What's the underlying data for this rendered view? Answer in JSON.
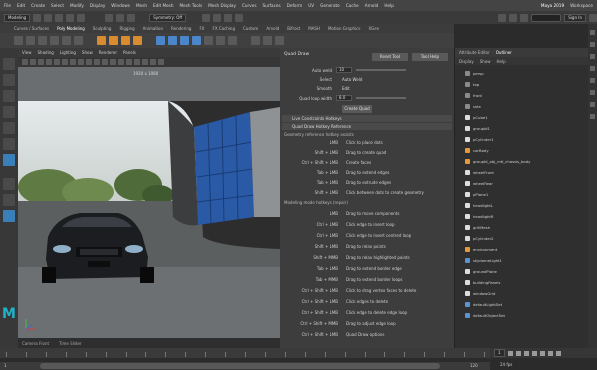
{
  "app": {
    "title": "Maya 2019",
    "logo_letter": "M",
    "accent": "#1fb3c8"
  },
  "menubar": {
    "items": [
      "File",
      "Edit",
      "Create",
      "Select",
      "Modify",
      "Display",
      "Windows",
      "Mesh",
      "Edit Mesh",
      "Mesh Tools",
      "Mesh Display",
      "Curves",
      "Surfaces",
      "Deform",
      "UV",
      "Generate",
      "Cache",
      "Arnold",
      "Help"
    ],
    "workspace": "Workspace"
  },
  "status": {
    "mode": "Modeling",
    "symmetry": "Symmetry: Off",
    "sign_in": "Sign In"
  },
  "shelf": {
    "tabs": [
      "Curves / Surfaces",
      "Poly Modeling",
      "Sculpting",
      "Rigging",
      "Animation",
      "Rendering",
      "FX",
      "FX Caching",
      "Custom",
      "Arnold",
      "Bifrost",
      "MASH",
      "Motion Graphics",
      "XGen"
    ],
    "active": "Poly Modeling"
  },
  "viewport": {
    "menu": [
      "View",
      "Shading",
      "Lighting",
      "Show",
      "Renderer",
      "Panels"
    ],
    "bottom_left": "Camera Front",
    "bottom_mid": "Time Slider",
    "res_label": "1920 x 1080"
  },
  "tool_settings": {
    "title": "Quad Draw",
    "reset_tool": "Reset Tool",
    "tool_help": "Tool Help",
    "fields": [
      {
        "label": "Auto weld",
        "value": "10"
      },
      {
        "label": "Select",
        "value": "Auto Weld"
      },
      {
        "label": "Smooth",
        "value": "Edit"
      },
      {
        "label": "Quad loop width",
        "value": "8.0"
      }
    ],
    "create_button": "Create Quad",
    "sections": [
      "Live Constraints Hotkeys",
      "Quad Draw Hotkey Reference"
    ],
    "section_caption": "Geometry reference hotkey assists",
    "hotkeys_top": [
      {
        "key": "LMB",
        "desc": "Click to place dots"
      },
      {
        "key": "Shift + LMB",
        "desc": "Drag to create quad"
      },
      {
        "key": "Ctrl + Shift + LMB",
        "desc": "Create faces"
      },
      {
        "key": "Tab + LMB",
        "desc": "Drag to extend edges"
      },
      {
        "key": "Tab + LMB",
        "desc": "Drag to extrude edges"
      },
      {
        "key": "Shift + LMB",
        "desc": "Click between dots to create geometry"
      }
    ],
    "caption_2": "Modeling mode hotkeys (repair)",
    "hotkeys_bottom": [
      {
        "key": "LMB",
        "desc": "Drag to move components"
      },
      {
        "key": "Ctrl + LMB",
        "desc": "Click edge to insert loop"
      },
      {
        "key": "Ctrl + LMB",
        "desc": "Click edge to insert centred loop"
      },
      {
        "key": "Shift + LMB",
        "desc": "Drag to relax points"
      },
      {
        "key": "Shift + MMB",
        "desc": "Drag to relax highlighted points"
      },
      {
        "key": "Tab + LMB",
        "desc": "Drag to extend border edge"
      },
      {
        "key": "Tab + MMB",
        "desc": "Drag to extend border loops"
      },
      {
        "key": "Ctrl + Shift + LMB",
        "desc": "Click to drag vertex faces to delete"
      },
      {
        "key": "Ctrl + Shift + LMB",
        "desc": "Click edges to delete"
      },
      {
        "key": "Ctrl + Shift + LMB",
        "desc": "Click edge to delete edge loop"
      },
      {
        "key": "Ctrl + Shift + MMB",
        "desc": "Drag to adjust edge loop"
      },
      {
        "key": "Ctrl + Shift + LMB",
        "desc": "Quad Draw options"
      }
    ]
  },
  "outliner": {
    "tabs": [
      "Attribute Editor",
      "Outliner"
    ],
    "active_tab": "Outliner",
    "menu": [
      "Display",
      "Show",
      "Help"
    ],
    "items": [
      {
        "name": "persp",
        "icon": "camera"
      },
      {
        "name": "top",
        "icon": "camera"
      },
      {
        "name": "front",
        "icon": "camera"
      },
      {
        "name": "side",
        "icon": "camera"
      },
      {
        "name": "pCube1",
        "icon": "mesh"
      },
      {
        "name": "groupId1",
        "icon": "mesh"
      },
      {
        "name": "pCylinder1",
        "icon": "mesh"
      },
      {
        "name": "carBody",
        "icon": "group"
      },
      {
        "name": "groupId_obj_mtl_chassis_body",
        "icon": "group"
      },
      {
        "name": "wheelFront",
        "icon": "mesh"
      },
      {
        "name": "wheelRear",
        "icon": "mesh"
      },
      {
        "name": "pPlane1",
        "icon": "mesh"
      },
      {
        "name": "headlightL",
        "icon": "mesh"
      },
      {
        "name": "headlightR",
        "icon": "mesh"
      },
      {
        "name": "grillMesh",
        "icon": "mesh"
      },
      {
        "name": "pCylinder2",
        "icon": "mesh"
      },
      {
        "name": "environment",
        "icon": "group"
      },
      {
        "name": "skydomeLight1",
        "icon": "light"
      },
      {
        "name": "groundPlane",
        "icon": "mesh"
      },
      {
        "name": "buildingPanels",
        "icon": "mesh"
      },
      {
        "name": "windowGrid",
        "icon": "mesh"
      },
      {
        "name": "defaultLightSet",
        "icon": "set"
      },
      {
        "name": "defaultObjectSet",
        "icon": "set"
      }
    ]
  },
  "timeline": {
    "ticks": [
      "1",
      "5",
      "10",
      "15",
      "20",
      "25",
      "30",
      "35",
      "40",
      "45",
      "50",
      "55",
      "60",
      "65",
      "70",
      "75",
      "80",
      "85",
      "90",
      "95",
      "100",
      "105",
      "110",
      "115",
      "120"
    ],
    "current_frame": "1",
    "range_start": "1",
    "range_end": "120",
    "fps": "24 fps"
  }
}
